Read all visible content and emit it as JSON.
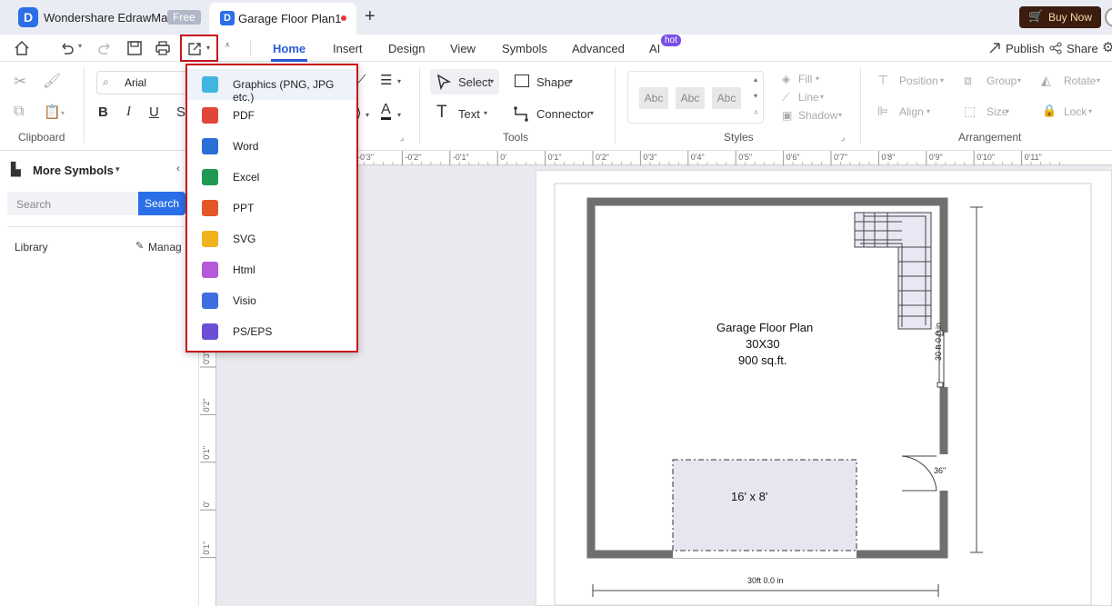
{
  "titlebar": {
    "app_name": "Wondershare EdrawMax",
    "free_badge": "Free",
    "doc_tab": "Garage Floor Plan1",
    "new_tab": "+",
    "buy_now": "Buy Now"
  },
  "menu_tabs": [
    "Home",
    "Insert",
    "Design",
    "View",
    "Symbols",
    "Advanced",
    "AI"
  ],
  "ai_badge": "hot",
  "header_actions": {
    "publish": "Publish",
    "share": "Share"
  },
  "ribbon": {
    "font_name": "Arial",
    "clipboard_label": "Clipboard",
    "select_label": "Select",
    "shape_label": "Shape",
    "text_label": "Text",
    "connector_label": "Connector",
    "tools_label": "Tools",
    "style_samples": [
      "Abc",
      "Abc",
      "Abc"
    ],
    "fill_label": "Fill",
    "line_label": "Line",
    "shadow_label": "Shadow",
    "styles_label": "Styles",
    "position_label": "Position",
    "group_label": "Group",
    "rotate_label": "Rotate",
    "align_label": "Align",
    "size_label": "Size",
    "lock_label": "Lock",
    "arrangement_label": "Arrangement"
  },
  "left_panel": {
    "title": "More Symbols",
    "search_placeholder": "Search",
    "search_button": "Search",
    "library_label": "Library",
    "manage_label": "Manag"
  },
  "export_menu": [
    {
      "label": "Graphics (PNG, JPG etc.)",
      "icon": "image-icon",
      "color": "#3fb6e0"
    },
    {
      "label": "PDF",
      "icon": "pdf-icon",
      "color": "#e0463a"
    },
    {
      "label": "Word",
      "icon": "word-icon",
      "color": "#2b6fd6"
    },
    {
      "label": "Excel",
      "icon": "excel-icon",
      "color": "#1f9a54"
    },
    {
      "label": "PPT",
      "icon": "ppt-icon",
      "color": "#e2562a"
    },
    {
      "label": "SVG",
      "icon": "svg-icon",
      "color": "#f2b21d"
    },
    {
      "label": "Html",
      "icon": "html-icon",
      "color": "#b45ad8"
    },
    {
      "label": "Visio",
      "icon": "visio-icon",
      "color": "#3d6fe0"
    },
    {
      "label": "PS/EPS",
      "icon": "ps-eps-icon",
      "color": "#6b4fd6"
    }
  ],
  "h_ruler_ticks": [
    "-0'3\"",
    "-0'2\"",
    "-0'1\"",
    "0'",
    "0'1\"",
    "0'2\"",
    "0'3\"",
    "0'4\"",
    "0'5\"",
    "0'6\"",
    "0'7\"",
    "0'8\"",
    "0'9\"",
    "0'10\"",
    "0'11\""
  ],
  "v_ruler_ticks": [
    "0'3\"",
    "0'2\"",
    "0'1\"",
    "0'",
    "0'1\""
  ],
  "drawing": {
    "title_line1": "Garage Floor Plan",
    "title_line2": "30X30",
    "title_line3": "900 sq.ft.",
    "car_label": "16' x 8'",
    "width_dim": "30ft 0.0 in",
    "height_dim": "30 ft 0.0 in",
    "door_label": "36\""
  },
  "colors": {
    "accent": "#2a5bd7",
    "highlight": "#c8161d",
    "wall": "#6f6f6f"
  }
}
